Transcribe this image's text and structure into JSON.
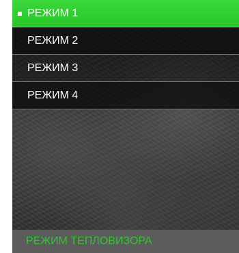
{
  "menu": {
    "items": [
      {
        "label": "РЕЖИМ 1",
        "selected": true
      },
      {
        "label": "РЕЖИМ 2",
        "selected": false
      },
      {
        "label": "РЕЖИМ 3",
        "selected": false
      },
      {
        "label": "РЕЖИМ 4",
        "selected": false
      }
    ]
  },
  "footer": {
    "label": "РЕЖИМ ТЕПЛОВИЗОРА"
  },
  "colors": {
    "accent": "#2fd02f",
    "footer_text": "#31c631",
    "item_text": "#ffffff"
  },
  "icons": {
    "selection_marker": "square-bullet-icon"
  }
}
